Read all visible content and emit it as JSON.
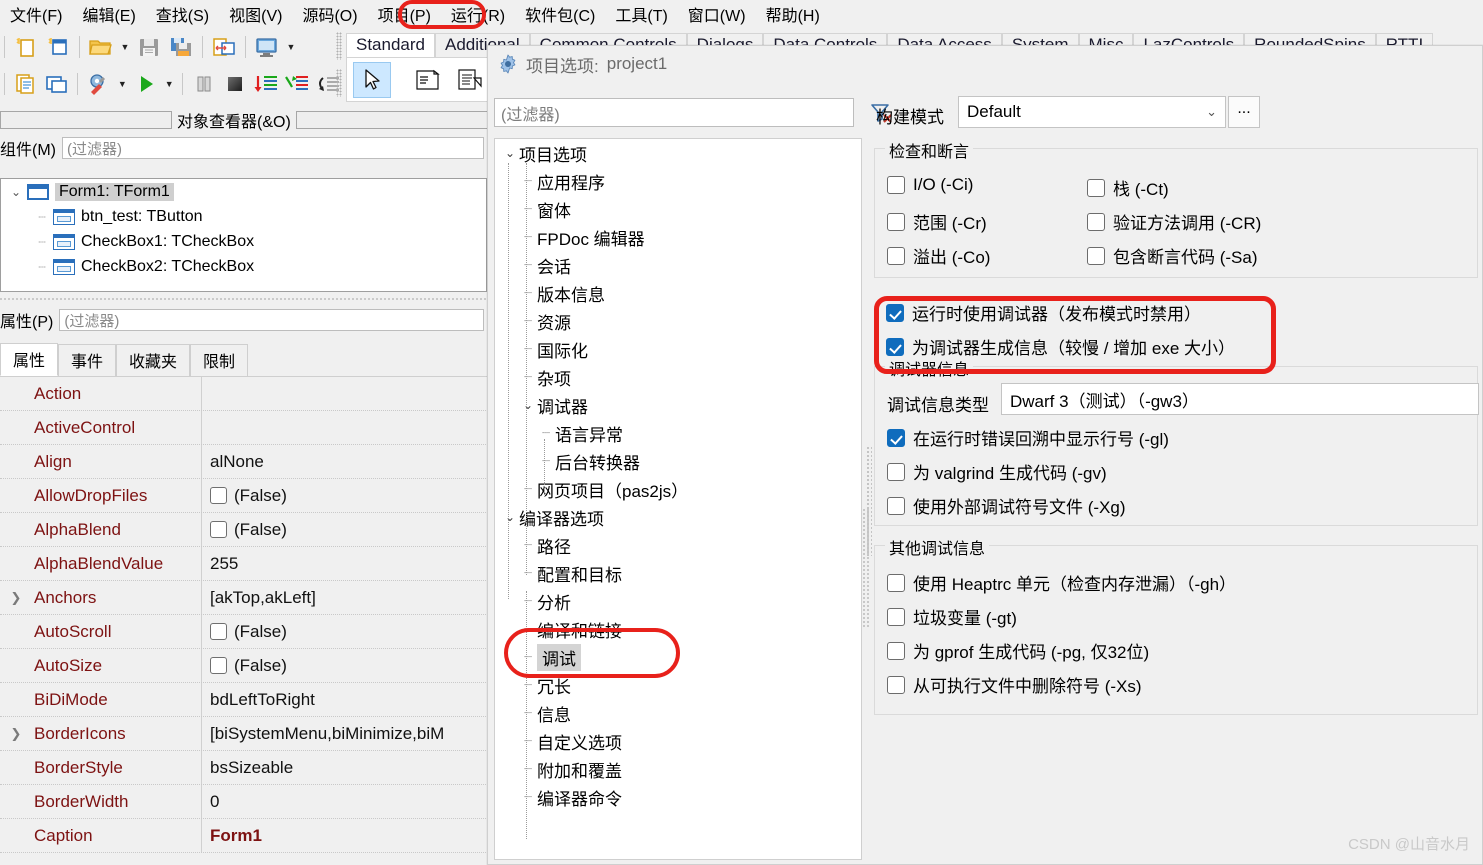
{
  "menubar": {
    "items": [
      {
        "label": "文件(F)",
        "highlighted": false
      },
      {
        "label": "编辑(E)",
        "highlighted": false
      },
      {
        "label": "查找(S)",
        "highlighted": false
      },
      {
        "label": "视图(V)",
        "highlighted": false
      },
      {
        "label": "源码(O)",
        "highlighted": false
      },
      {
        "label": "项目(P)",
        "highlighted": true
      },
      {
        "label": "运行(R)",
        "highlighted": false
      },
      {
        "label": "软件包(C)",
        "highlighted": false
      },
      {
        "label": "工具(T)",
        "highlighted": false
      },
      {
        "label": "窗口(W)",
        "highlighted": false
      },
      {
        "label": "帮助(H)",
        "highlighted": false
      }
    ]
  },
  "toolbar": {
    "row1": [
      "new-unit-icon",
      "new-form-icon",
      "open-file-icon",
      "open-dropdown-icon",
      "save-icon",
      "save-all-icon",
      "toggle-unit-form-icon",
      "view-units-icon",
      "view-units-dropdown-icon"
    ],
    "row2": [
      "view-forms-icon",
      "new-window-icon",
      "build-icon",
      "build-dropdown-icon",
      "run-icon",
      "run-dropdown-icon",
      "pause-icon",
      "stop-icon",
      "step-into-icon",
      "step-over-icon",
      "step-out-icon"
    ]
  },
  "palette": {
    "tabs": [
      {
        "label": "Standard",
        "active": true
      },
      {
        "label": "Additional",
        "active": false
      },
      {
        "label": "Common Controls",
        "active": false
      },
      {
        "label": "Dialogs",
        "active": false
      },
      {
        "label": "Data Controls",
        "active": false
      },
      {
        "label": "Data Access",
        "active": false
      },
      {
        "label": "System",
        "active": false
      },
      {
        "label": "Misc",
        "active": false
      },
      {
        "label": "LazControls",
        "active": false
      },
      {
        "label": "RoundedSpins",
        "active": false
      },
      {
        "label": "RTTI",
        "active": false
      }
    ],
    "buttons": [
      "pointer-icon",
      "tmainmenu-icon",
      "tpopupmenu-icon"
    ]
  },
  "object_inspector": {
    "title": "对象查看器(&O)",
    "components": {
      "label": "组件(M)",
      "label_mnemonic": "M",
      "filter_placeholder": "(过滤器)",
      "tree": [
        {
          "label": "Form1: TForm1",
          "icon": "form-icon",
          "depth": 0,
          "expanded": true,
          "selected": true
        },
        {
          "label": "btn_test: TButton",
          "icon": "button-icon",
          "depth": 1,
          "expanded": false,
          "selected": false
        },
        {
          "label": "CheckBox1: TCheckBox",
          "icon": "checkbox-icon",
          "depth": 1,
          "expanded": false,
          "selected": false
        },
        {
          "label": "CheckBox2: TCheckBox",
          "icon": "checkbox-icon",
          "depth": 1,
          "expanded": false,
          "selected": false
        }
      ]
    },
    "properties": {
      "label": "属性(P)",
      "label_mnemonic": "P",
      "filter_placeholder": "(过滤器)",
      "tabs": [
        {
          "label": "属性",
          "active": true
        },
        {
          "label": "事件",
          "active": false
        },
        {
          "label": "收藏夹",
          "active": false
        },
        {
          "label": "限制",
          "active": false
        }
      ],
      "rows": [
        {
          "name": "Action",
          "value": "",
          "type": "text",
          "expandable": false
        },
        {
          "name": "ActiveControl",
          "value": "",
          "type": "text",
          "expandable": false
        },
        {
          "name": "Align",
          "value": "alNone",
          "type": "text",
          "expandable": false
        },
        {
          "name": "AllowDropFiles",
          "value": "(False)",
          "type": "checkbox",
          "checked": false,
          "expandable": false
        },
        {
          "name": "AlphaBlend",
          "value": "(False)",
          "type": "checkbox",
          "checked": false,
          "expandable": false
        },
        {
          "name": "AlphaBlendValue",
          "value": "255",
          "type": "text",
          "expandable": false
        },
        {
          "name": "Anchors",
          "value": "[akTop,akLeft]",
          "type": "text",
          "expandable": true
        },
        {
          "name": "AutoScroll",
          "value": "(False)",
          "type": "checkbox",
          "checked": false,
          "expandable": false
        },
        {
          "name": "AutoSize",
          "value": "(False)",
          "type": "checkbox",
          "checked": false,
          "expandable": false
        },
        {
          "name": "BiDiMode",
          "value": "bdLeftToRight",
          "type": "text",
          "expandable": false
        },
        {
          "name": "BorderIcons",
          "value": "[biSystemMenu,biMinimize,biM",
          "type": "text",
          "expandable": true
        },
        {
          "name": "BorderStyle",
          "value": "bsSizeable",
          "type": "text",
          "expandable": false
        },
        {
          "name": "BorderWidth",
          "value": "0",
          "type": "text",
          "expandable": false
        },
        {
          "name": "Caption",
          "value": "Form1",
          "type": "bold",
          "expandable": false
        }
      ]
    }
  },
  "dialog": {
    "title_prefix": "项目选项:",
    "title_project": "project1",
    "icon": "gear-icon",
    "filter_placeholder": "(过滤器)",
    "filter_clear_icon": "filter-clear-icon",
    "build_mode": {
      "label": "构建模式",
      "value": "Default",
      "dropdown_icon": "chevron-down-icon",
      "more_button": "..."
    },
    "tree": [
      {
        "label": "项目选项",
        "depth": 0,
        "expanded": true,
        "selected": false
      },
      {
        "label": "应用程序",
        "depth": 1,
        "expanded": null,
        "selected": false
      },
      {
        "label": "窗体",
        "depth": 1,
        "expanded": null,
        "selected": false
      },
      {
        "label": "FPDoc 编辑器",
        "depth": 1,
        "expanded": null,
        "selected": false
      },
      {
        "label": "会话",
        "depth": 1,
        "expanded": null,
        "selected": false
      },
      {
        "label": "版本信息",
        "depth": 1,
        "expanded": null,
        "selected": false
      },
      {
        "label": "资源",
        "depth": 1,
        "expanded": null,
        "selected": false
      },
      {
        "label": "国际化",
        "depth": 1,
        "expanded": null,
        "selected": false
      },
      {
        "label": "杂项",
        "depth": 1,
        "expanded": null,
        "selected": false
      },
      {
        "label": "调试器",
        "depth": 1,
        "expanded": true,
        "selected": false
      },
      {
        "label": "语言异常",
        "depth": 2,
        "expanded": null,
        "selected": false
      },
      {
        "label": "后台转换器",
        "depth": 2,
        "expanded": null,
        "selected": false
      },
      {
        "label": "网页项目（pas2js）",
        "depth": 1,
        "expanded": null,
        "selected": false
      },
      {
        "label": "编译器选项",
        "depth": 0,
        "expanded": true,
        "selected": false
      },
      {
        "label": "路径",
        "depth": 1,
        "expanded": null,
        "selected": false
      },
      {
        "label": "配置和目标",
        "depth": 1,
        "expanded": null,
        "selected": false
      },
      {
        "label": "分析",
        "depth": 1,
        "expanded": null,
        "selected": false
      },
      {
        "label": "编译和链接",
        "depth": 1,
        "expanded": null,
        "selected": false
      },
      {
        "label": "调试",
        "depth": 1,
        "expanded": null,
        "selected": true
      },
      {
        "label": "冗长",
        "depth": 1,
        "expanded": null,
        "selected": false
      },
      {
        "label": "信息",
        "depth": 1,
        "expanded": null,
        "selected": false
      },
      {
        "label": "自定义选项",
        "depth": 1,
        "expanded": null,
        "selected": false
      },
      {
        "label": "附加和覆盖",
        "depth": 1,
        "expanded": null,
        "selected": false
      },
      {
        "label": "编译器命令",
        "depth": 1,
        "expanded": null,
        "selected": false
      }
    ],
    "checks_group": {
      "title": "检查和断言",
      "items_left": [
        {
          "label": "I/O (-Ci)",
          "checked": false
        },
        {
          "label": "范围 (-Cr)",
          "checked": false
        },
        {
          "label": "溢出 (-Co)",
          "checked": false
        }
      ],
      "items_right": [
        {
          "label": "栈 (-Ct)",
          "checked": false
        },
        {
          "label": "验证方法调用 (-CR)",
          "checked": false
        },
        {
          "label": "包含断言代码 (-Sa)",
          "checked": false
        }
      ]
    },
    "highlighted_checks": [
      {
        "label": "运行时使用调试器（发布模式时禁用）",
        "checked": true
      },
      {
        "label": "为调试器生成信息（较慢 / 增加 exe 大小）",
        "checked": true
      }
    ],
    "debug_info_group": {
      "title": "调试器信息",
      "type_label": "调试信息类型",
      "type_value": "Dwarf 3（测试）（-gw3）",
      "items": [
        {
          "label": "在运行时错误回溯中显示行号 (-gl)",
          "checked": true
        },
        {
          "label": "为 valgrind 生成代码 (-gv)",
          "checked": false
        },
        {
          "label": "使用外部调试符号文件 (-Xg)",
          "checked": false
        }
      ]
    },
    "other_debug_group": {
      "title": "其他调试信息",
      "items": [
        {
          "label": "使用 Heaptrc 单元（检查内存泄漏）（-gh）",
          "checked": false
        },
        {
          "label": "垃圾变量 (-gt)",
          "checked": false
        },
        {
          "label": "为 gprof 生成代码 (-pg, 仅32位)",
          "checked": false
        },
        {
          "label": "从可执行文件中删除符号 (-Xs)",
          "checked": false
        }
      ]
    }
  },
  "annotations": {
    "color": "#e8211b",
    "rings": [
      "menu-project-ring",
      "debug-tree-node-ring",
      "debugger-checks-ring"
    ]
  },
  "watermark": "CSDN @山音水月"
}
